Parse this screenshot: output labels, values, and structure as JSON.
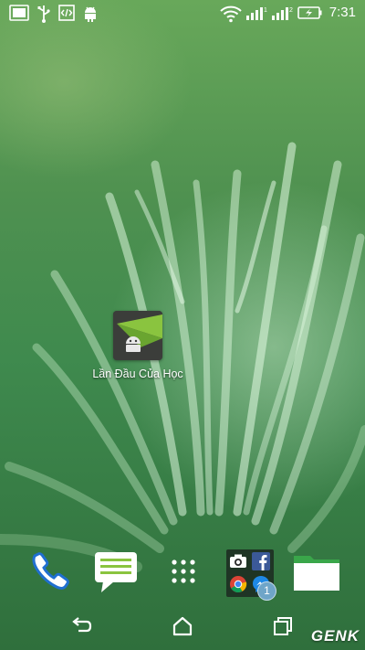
{
  "status_bar": {
    "time": "7:31",
    "left_icons": [
      "gallery-icon",
      "usb-icon",
      "developer-code-icon",
      "android-debug-icon"
    ],
    "right_icons": [
      "wifi-icon",
      "signal-1-icon",
      "signal-2-icon",
      "battery-charging-icon"
    ]
  },
  "desktop": {
    "app_label": "Lần Đầu Của Học",
    "app_icon": "android-airdroid-icon"
  },
  "dock": {
    "items": [
      "phone-icon",
      "messages-icon",
      "all-apps-icon",
      "folder-social",
      "file-manager-icon"
    ],
    "folder_apps": [
      "camera-icon",
      "facebook-icon",
      "chrome-icon",
      "messenger-icon"
    ],
    "folder_badge": "1"
  },
  "nav": {
    "buttons": [
      "back-icon",
      "home-icon",
      "recent-apps-icon"
    ]
  },
  "watermark": "GENK",
  "colors": {
    "accent_green": "#8ac43f",
    "folder_green": "#3aa64a",
    "phone_blue": "#1f6fd0"
  }
}
